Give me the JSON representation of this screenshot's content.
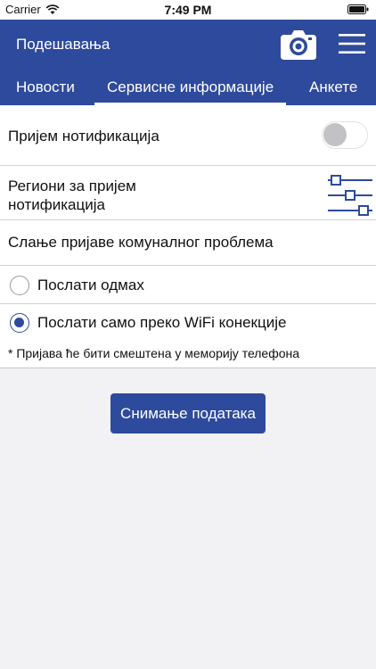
{
  "status_bar": {
    "carrier": "Carrier",
    "time": "7:49 PM"
  },
  "header": {
    "title": "Подешавања",
    "camera_icon": "camera-icon",
    "menu_icon": "hamburger-menu-icon",
    "color": "#2e4a9c"
  },
  "tabs": [
    {
      "label": "Новости",
      "active": false
    },
    {
      "label": "Сервисне информације",
      "active": true
    },
    {
      "label": "Анкете",
      "active": false
    }
  ],
  "settings": {
    "notifications": {
      "label": "Пријем нотификација",
      "enabled": false
    },
    "regions": {
      "line1": "Региони за пријем",
      "line2": "нотификација",
      "icon": "sliders-icon"
    },
    "report_heading": "Слање пријаве комуналног проблема",
    "options": [
      {
        "label": "Послати одмах",
        "selected": false
      },
      {
        "label": "Послати само преко WiFi конекције",
        "selected": true
      }
    ],
    "note": "* Пријава ће бити смештена у меморију телефона"
  },
  "save_button": {
    "label": "Снимање података"
  }
}
